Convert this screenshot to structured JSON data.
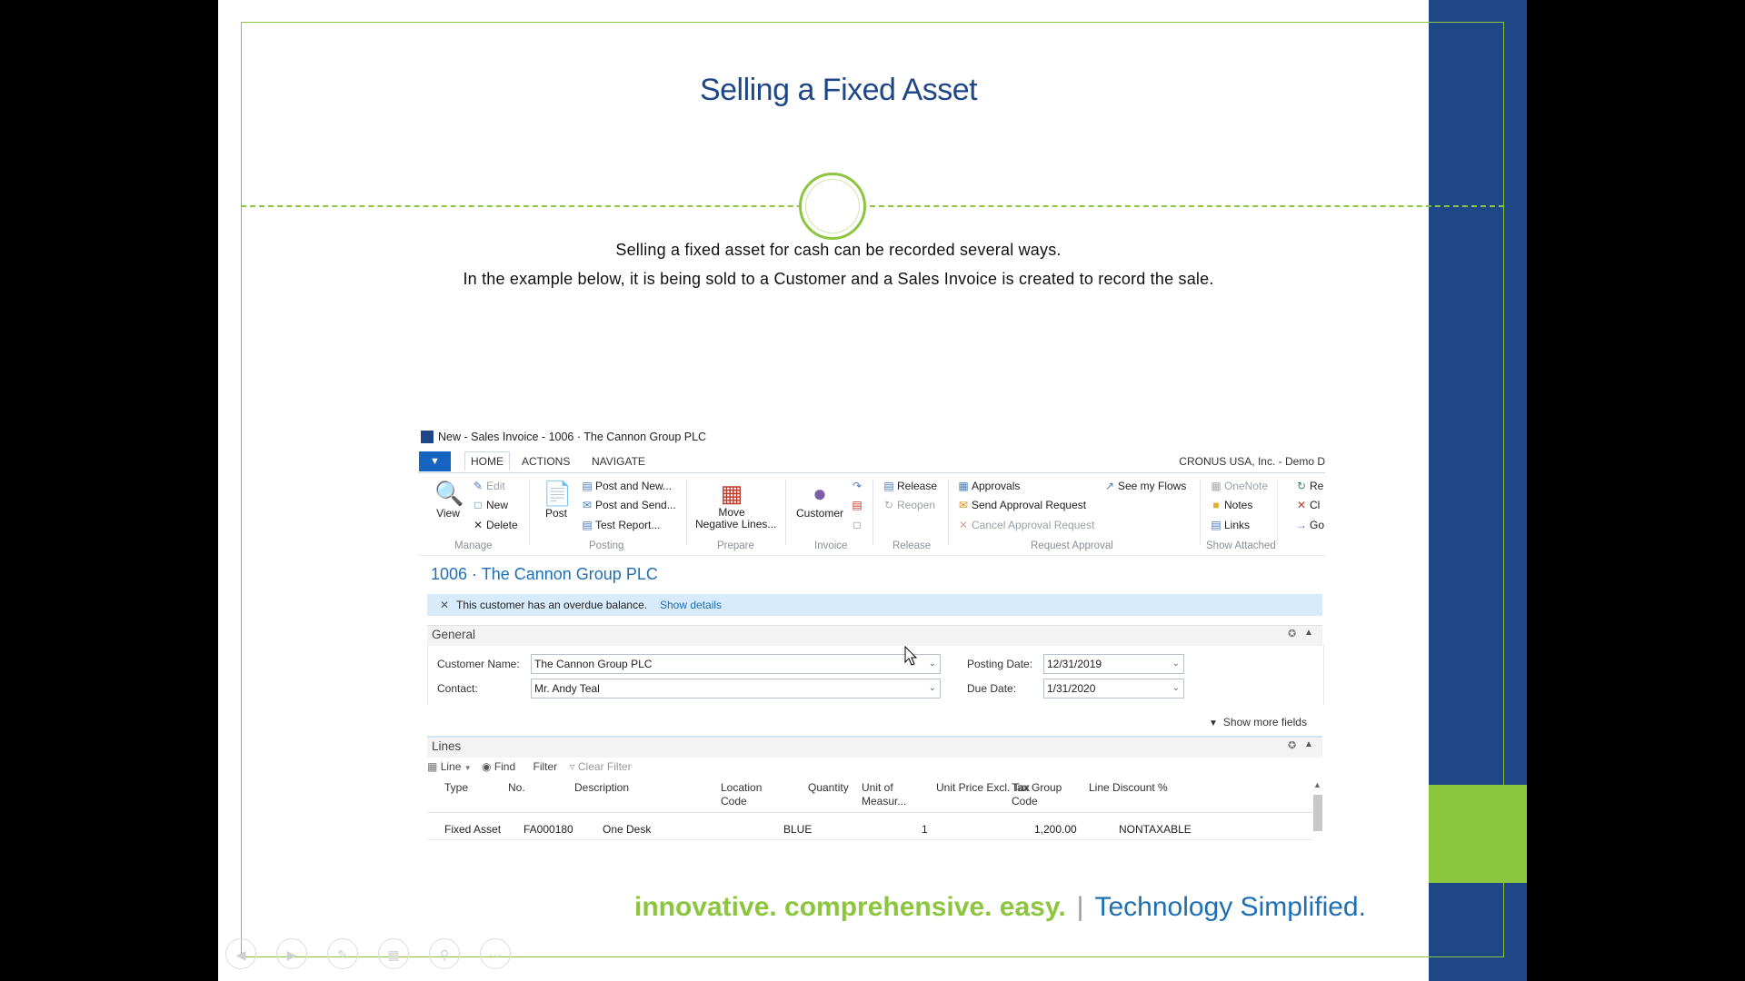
{
  "slide": {
    "title": "Selling a Fixed Asset",
    "intro_line1": "Selling a fixed asset for cash can be recorded several ways.",
    "intro_line2": "In the example below, it is being sold to a Customer and a Sales Invoice is created to record the sale.",
    "tagline_green": "innovative. comprehensive. easy.",
    "tagline_sep": "|",
    "tagline_blue": "Technology Simplified."
  },
  "window": {
    "title": "New - Sales Invoice - 1006 · The Cannon Group PLC",
    "app_button": "▼",
    "company": "CRONUS USA, Inc. - Demo D"
  },
  "tabs": [
    "HOME",
    "ACTIONS",
    "NAVIGATE"
  ],
  "ribbon": {
    "manage": {
      "view": "View",
      "edit": "Edit",
      "new": "New",
      "delete": "Delete",
      "group": "Manage"
    },
    "posting": {
      "post": "Post",
      "post_and_new": "Post and New...",
      "post_and_send": "Post and Send...",
      "test_report": "Test Report...",
      "group": "Posting"
    },
    "prepare": {
      "move_line1": "Move",
      "move_line2": "Negative Lines...",
      "group": "Prepare"
    },
    "invoice": {
      "customer": "Customer",
      "group": "Invoice"
    },
    "release": {
      "release": "Release",
      "reopen": "Reopen",
      "group": "Release"
    },
    "request_approval": {
      "approvals": "Approvals",
      "send": "Send Approval Request",
      "cancel": "Cancel Approval Request",
      "see_flows": "See my Flows",
      "group": "Request Approval"
    },
    "show_attached": {
      "onenote": "OneNote",
      "notes": "Notes",
      "links": "Links",
      "group": "Show Attached"
    },
    "extra": {
      "re": "Re",
      "cl": "Cl",
      "go": "Go"
    }
  },
  "record": {
    "title": "1006 · The Cannon Group PLC",
    "notification": "This customer has an overdue balance.",
    "show_details": "Show details"
  },
  "general": {
    "header": "General",
    "customer_name_label": "Customer Name:",
    "customer_name": "The Cannon Group PLC",
    "contact_label": "Contact:",
    "contact": "Mr. Andy Teal",
    "posting_date_label": "Posting Date:",
    "posting_date": "12/31/2019",
    "due_date_label": "Due Date:",
    "due_date": "1/31/2020",
    "show_more": "Show more fields"
  },
  "lines": {
    "header": "Lines",
    "toolbar": {
      "line": "Line",
      "find": "Find",
      "filter": "Filter",
      "clear_filter": "Clear Filter"
    },
    "columns": {
      "type": "Type",
      "no": "No.",
      "description": "Description",
      "location_1": "Location",
      "location_2": "Code",
      "quantity": "Quantity",
      "uom_1": "Unit of",
      "uom_2": "Measur...",
      "unit_price": "Unit Price Excl. Tax",
      "tax_1": "Tax Group",
      "tax_2": "Code",
      "discount": "Line Discount %"
    },
    "row": {
      "type": "Fixed Asset",
      "no": "FA000180",
      "description": "One Desk",
      "location": "BLUE",
      "quantity": "1",
      "unit_price": "1,200.00",
      "tax_group": "NONTAXABLE"
    }
  },
  "colors": {
    "navy": "#1f4788",
    "green": "#8cc63f",
    "link_blue": "#1f6fb5"
  }
}
